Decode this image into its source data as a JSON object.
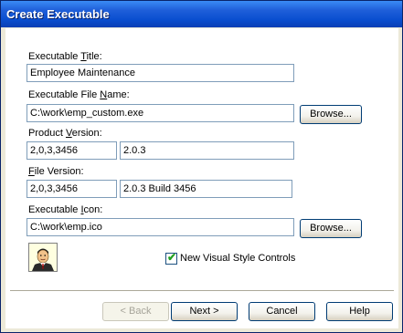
{
  "window": {
    "title": "Create Executable"
  },
  "fields": {
    "exe_title": {
      "label_pre": "Executable ",
      "label_u": "T",
      "label_post": "itle:",
      "value": "Employee Maintenance"
    },
    "exe_file": {
      "label_pre": "Executable File ",
      "label_u": "N",
      "label_post": "ame:",
      "value": "C:\\work\\emp_custom.exe",
      "browse": "Browse..."
    },
    "product_version": {
      "label_pre": "Product ",
      "label_u": "V",
      "label_post": "ersion:",
      "value_numeric": "2,0,3,3456",
      "value_text": "2.0.3"
    },
    "file_version": {
      "label_pre": "",
      "label_u": "F",
      "label_post": "ile Version:",
      "value_numeric": "2,0,3,3456",
      "value_text": "2.0.3 Build 3456"
    },
    "exe_icon": {
      "label_pre": "Executable ",
      "label_u": "I",
      "label_post": "con:",
      "value": "C:\\work\\emp.ico",
      "browse": "Browse..."
    }
  },
  "checkbox": {
    "label": "New Visual Style Controls",
    "checked": true
  },
  "buttons": {
    "back": "< Back",
    "next": "Next >",
    "cancel": "Cancel",
    "help": "Help"
  },
  "colors": {
    "title_blue": "#0a4fd0",
    "face": "#ece9d8",
    "field_border": "#7f9db9"
  },
  "icons": {
    "exe_icon_preview": "person-icon"
  }
}
